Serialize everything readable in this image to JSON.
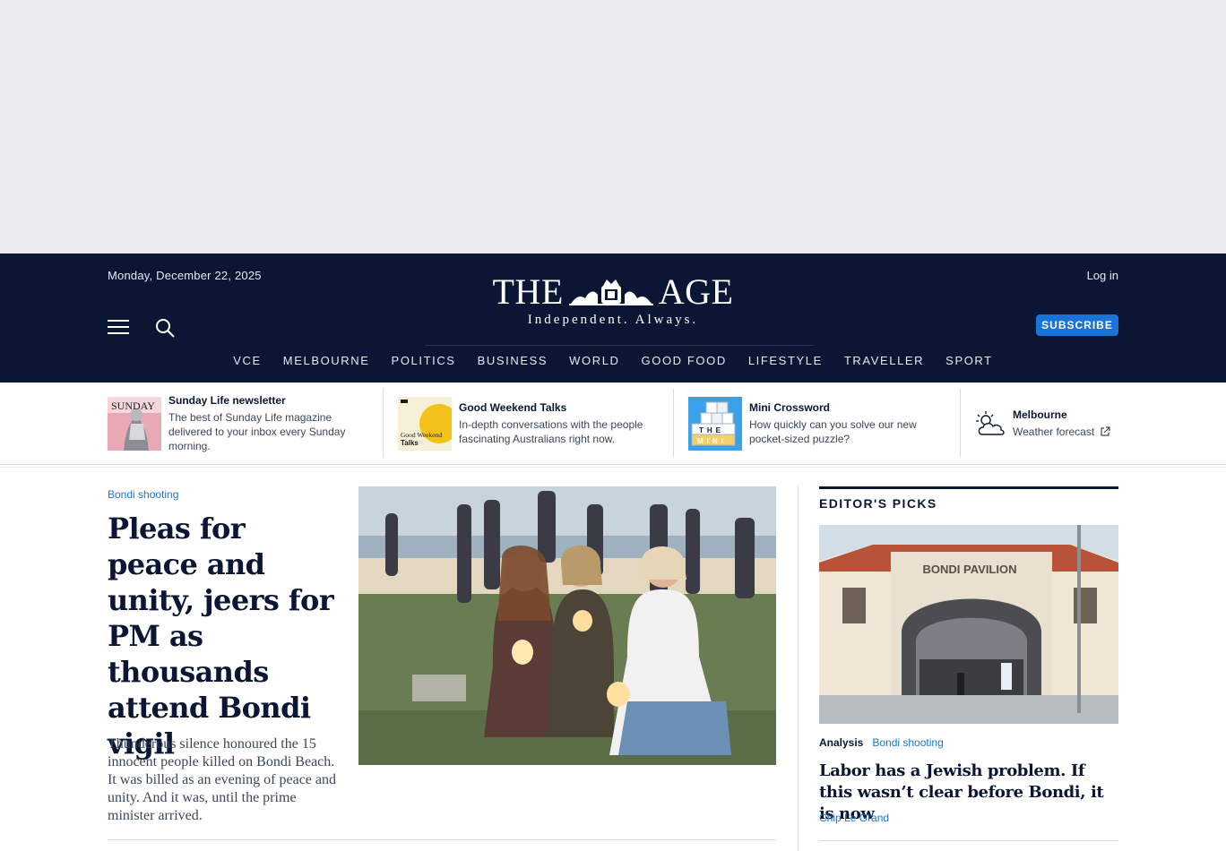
{
  "header": {
    "date": "Monday, December 22, 2025",
    "login_label": "Log in",
    "logo_text_left": "THE",
    "logo_text_right": "AGE",
    "logo_tagline": "Independent. Always.",
    "subscribe_label": "SUBSCRIBE"
  },
  "nav": {
    "items": [
      "VCE",
      "MELBOURNE",
      "POLITICS",
      "BUSINESS",
      "WORLD",
      "GOOD FOOD",
      "LIFESTYLE",
      "TRAVELLER",
      "SPORT"
    ]
  },
  "promos": [
    {
      "title": "Sunday Life newsletter",
      "desc": "The best of Sunday Life magazine delivered to your inbox every Sunday morning.",
      "image_text": "SUNDAY"
    },
    {
      "title": "Good Weekend Talks",
      "desc": "In-depth conversations with the people fascinating Australians right now.",
      "image_text_1": "Good Weekend",
      "image_text_2": "Talks"
    },
    {
      "title": "Mini Crossword",
      "desc": "How quickly can you solve our new pocket-sized puzzle?",
      "image_text_1": "THE",
      "image_text_2": "MINI"
    }
  ],
  "weather": {
    "city": "Melbourne",
    "link_label": "Weather forecast",
    "icon": "partly-cloudy-icon"
  },
  "lead": {
    "kicker": "Bondi shooting",
    "headline": "Pleas for peace and unity, jeers for PM as thousands attend Bondi vigil",
    "standfirst": "Thunderous silence honoured the 15 innocent people killed on Bondi Beach. It was billed as an evening of peace and unity. And it was, until the prime minister arrived."
  },
  "editors_picks": {
    "title": "EDITOR'S PICKS",
    "photo_sign": "BONDI PAVILION",
    "tag_label": "Analysis",
    "tag_topic": "Bondi shooting",
    "headline": "Labor has a Jewish problem. If this wasn’t clear before Bondi, it is now",
    "author": "Chip Le Grand"
  },
  "colors": {
    "masthead_bg": "#0a1633",
    "accent_blue": "#1a73d9",
    "ad_bg": "#e8ebef"
  }
}
